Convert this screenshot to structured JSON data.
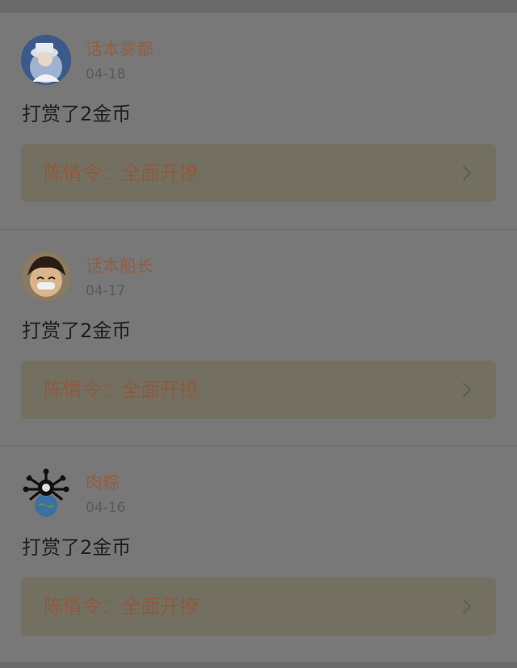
{
  "feed": {
    "items": [
      {
        "username": "话本雾都",
        "date": "04-18",
        "action": "打赏了2金币",
        "book_title": "陈情令：全面开撩"
      },
      {
        "username": "话本船长",
        "date": "04-17",
        "action": "打赏了2金币",
        "book_title": "陈情令：全面开撩"
      },
      {
        "username": "肉粽",
        "date": "04-16",
        "action": "打赏了2金币",
        "book_title": "陈情令：全面开撩"
      }
    ]
  },
  "icons": {
    "chevron": "chevron-right-icon"
  },
  "colors": {
    "username": "#8f5e45",
    "book_title": "#8c5a40",
    "overlay_background": "#6a6a6a"
  }
}
